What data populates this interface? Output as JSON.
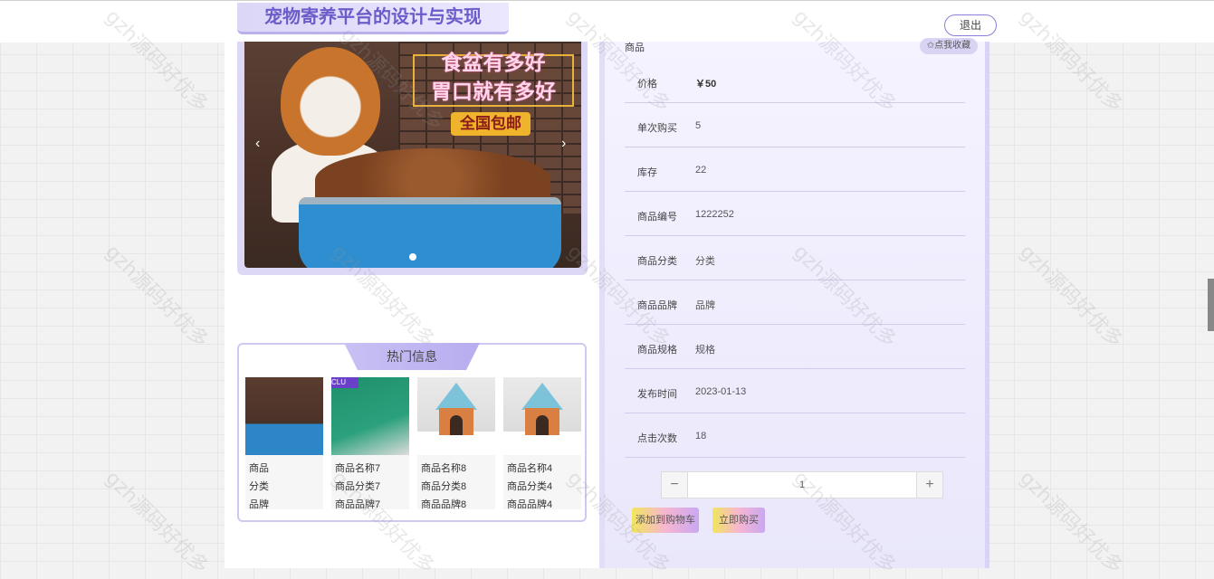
{
  "header": {
    "site_title": "宠物寄养平台的设计与实现",
    "logout_label": "退出"
  },
  "carousel": {
    "promo_line1": "食盆有多好",
    "promo_line2": "胃口就有多好",
    "promo_badge": "全国包邮",
    "prev_arrow": "‹",
    "next_arrow": "›"
  },
  "hot_info": {
    "title": "热门信息",
    "items": [
      {
        "name": "商品",
        "category": "分类",
        "brand": "品牌",
        "image": "dog-food-icon"
      },
      {
        "name": "商品名称7",
        "category": "商品分类7",
        "brand": "商品品牌7",
        "image": "cat-collar-icon",
        "tag": "CLU"
      },
      {
        "name": "商品名称8",
        "category": "商品分类8",
        "brand": "商品品牌8",
        "image": "pet-house-icon"
      },
      {
        "name": "商品名称4",
        "category": "商品分类4",
        "brand": "商品品牌4",
        "image": "pet-house-icon"
      }
    ]
  },
  "detail": {
    "heading": "商品",
    "favorite_label": "✩点我收藏",
    "rows": [
      {
        "label": "价格",
        "value": "￥50"
      },
      {
        "label": "单次购买",
        "value": "5"
      },
      {
        "label": "库存",
        "value": "22"
      },
      {
        "label": "商品编号",
        "value": "1222252"
      },
      {
        "label": "商品分类",
        "value": "分类"
      },
      {
        "label": "商品品牌",
        "value": "品牌"
      },
      {
        "label": "商品规格",
        "value": "规格"
      },
      {
        "label": "发布时间",
        "value": "2023-01-13"
      },
      {
        "label": "点击次数",
        "value": "18"
      }
    ],
    "quantity": "1",
    "minus_label": "−",
    "plus_label": "+",
    "add_to_cart_label": "添加到购物车",
    "buy_now_label": "立即购买"
  },
  "watermark_text": "gzh源码好优多",
  "colors": {
    "accent": "#8a7fd8",
    "panel": "#eae7fb"
  }
}
